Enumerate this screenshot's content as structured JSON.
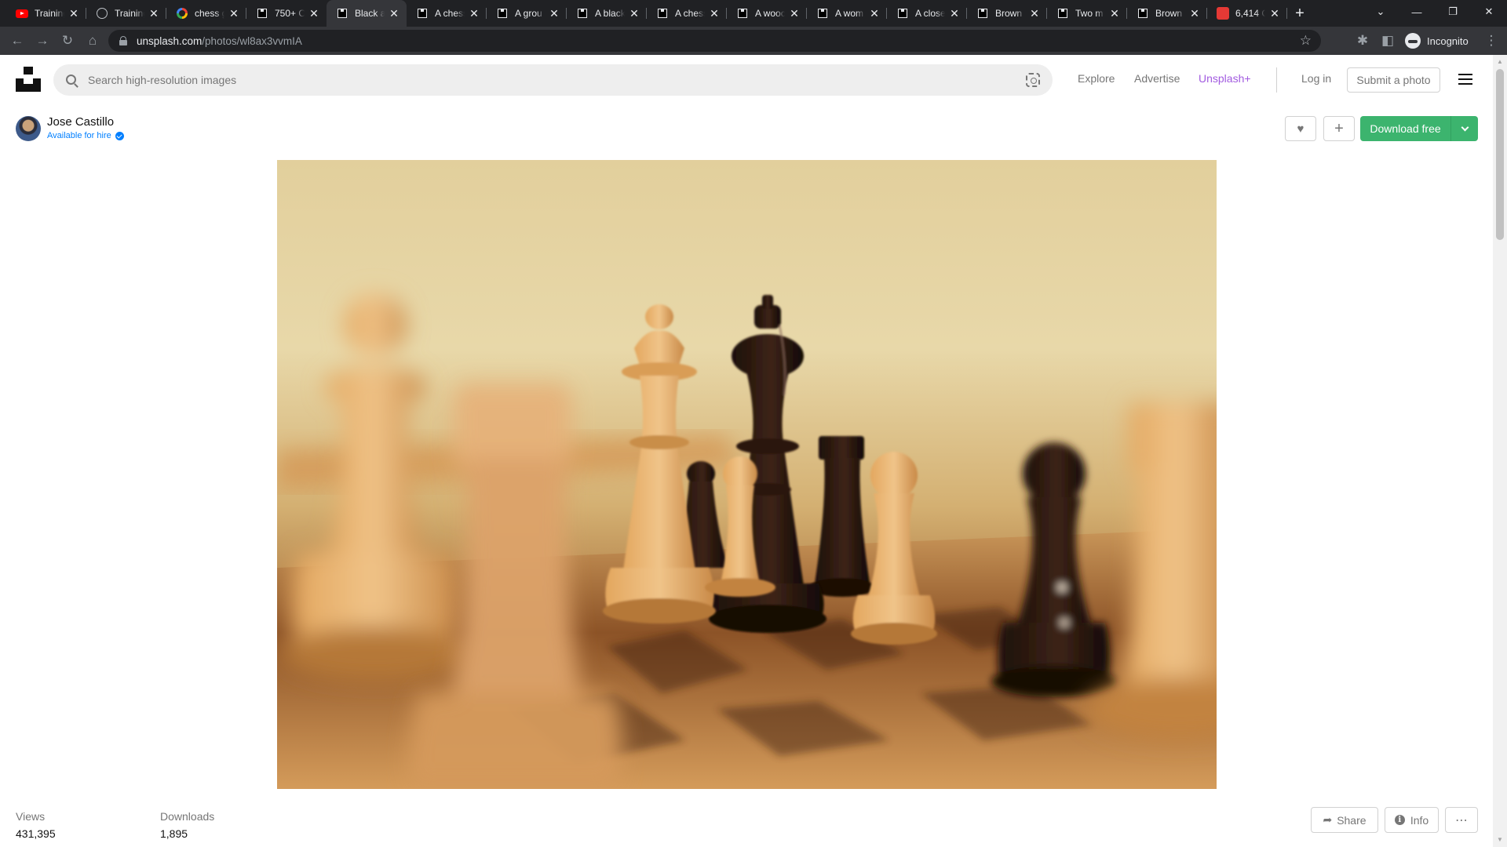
{
  "browser": {
    "tabs": [
      {
        "title": "Training",
        "favicon": "youtube-icon"
      },
      {
        "title": "Training",
        "favicon": "globe-icon"
      },
      {
        "title": "chess g",
        "favicon": "google-icon"
      },
      {
        "title": "750+ C",
        "favicon": "unsplash-icon"
      },
      {
        "title": "Black a",
        "favicon": "unsplash-icon",
        "active": true
      },
      {
        "title": "A chess",
        "favicon": "unsplash-icon"
      },
      {
        "title": "A grou",
        "favicon": "unsplash-icon"
      },
      {
        "title": "A black",
        "favicon": "unsplash-icon"
      },
      {
        "title": "A chess",
        "favicon": "unsplash-icon"
      },
      {
        "title": "A wooc",
        "favicon": "unsplash-icon"
      },
      {
        "title": "A wom",
        "favicon": "unsplash-icon"
      },
      {
        "title": "A close",
        "favicon": "unsplash-icon"
      },
      {
        "title": "Brown",
        "favicon": "unsplash-icon"
      },
      {
        "title": "Two m",
        "favicon": "unsplash-icon"
      },
      {
        "title": "Brown",
        "favicon": "unsplash-icon"
      },
      {
        "title": "6,414 C",
        "favicon": "red-app-icon"
      }
    ],
    "new_tab": "+",
    "tab_close": "✕",
    "url_host": "unsplash.com",
    "url_path": "/photos/wl8ax3vvmIA",
    "profile_label": "Incognito"
  },
  "header": {
    "search_placeholder": "Search high-resolution images",
    "nav": {
      "explore": "Explore",
      "advertise": "Advertise",
      "unsplash_plus": "Unsplash+"
    },
    "login": "Log in",
    "submit": "Submit a photo"
  },
  "author": {
    "name": "Jose Castillo",
    "hire_status": "Available for hire"
  },
  "actions": {
    "download": "Download free",
    "share": "Share",
    "info": "Info"
  },
  "stats": {
    "views_label": "Views",
    "views_value": "431,395",
    "downloads_label": "Downloads",
    "downloads_value": "1,895"
  },
  "colors": {
    "download_green": "#3cb46e",
    "unsplash_plus": "#a25be0",
    "hire_blue": "#007fff"
  }
}
